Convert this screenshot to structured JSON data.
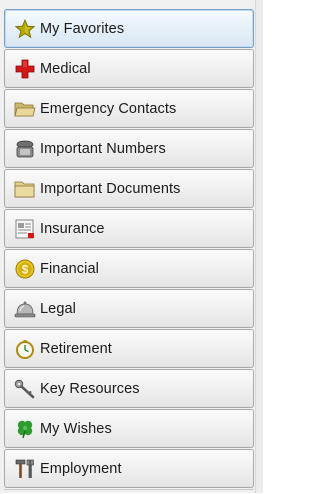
{
  "sidebar": {
    "items": [
      {
        "label": "My Favorites",
        "icon": "star-icon",
        "active": true
      },
      {
        "label": "Medical",
        "icon": "medical-cross-icon",
        "active": false
      },
      {
        "label": "Emergency Contacts",
        "icon": "open-folder-icon",
        "active": false
      },
      {
        "label": "Important Numbers",
        "icon": "telephone-icon",
        "active": false
      },
      {
        "label": "Important Documents",
        "icon": "folder-icon",
        "active": false
      },
      {
        "label": "Insurance",
        "icon": "document-icon",
        "active": false
      },
      {
        "label": "Financial",
        "icon": "dollar-coin-icon",
        "active": false
      },
      {
        "label": "Legal",
        "icon": "service-bell-icon",
        "active": false
      },
      {
        "label": "Retirement",
        "icon": "pocket-watch-icon",
        "active": false
      },
      {
        "label": "Key Resources",
        "icon": "key-icon",
        "active": false
      },
      {
        "label": "My Wishes",
        "icon": "four-leaf-clover-icon",
        "active": false
      },
      {
        "label": "Employment",
        "icon": "tools-icon",
        "active": false
      }
    ]
  },
  "colors": {
    "active_border": "#6ea0c8",
    "item_border": "#a8a8a8",
    "star": "#b5a800",
    "medical_cross": "#d01818",
    "folder": "#e2cf8a",
    "coin": "#e7c522",
    "clover": "#2f9a2f"
  }
}
